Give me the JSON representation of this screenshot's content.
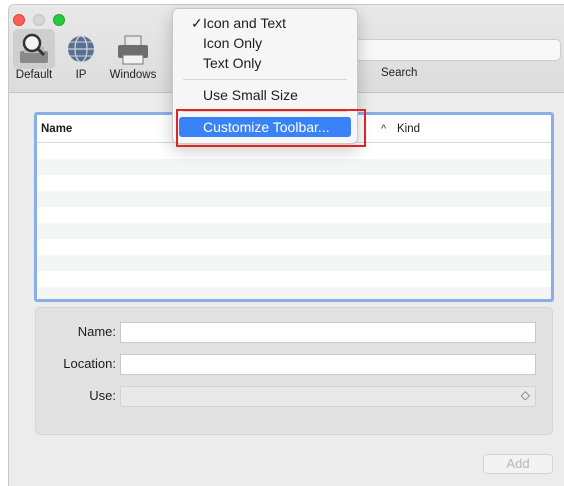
{
  "toolbar": {
    "items": [
      {
        "label": "Default",
        "icon": "magnifier-printer-icon",
        "selected": true
      },
      {
        "label": "IP",
        "icon": "globe-icon",
        "selected": false
      },
      {
        "label": "Windows",
        "icon": "printer-icon",
        "selected": false
      }
    ],
    "search_label": "Search"
  },
  "context_menu": {
    "items": [
      {
        "label": "Icon and Text",
        "checked": true
      },
      {
        "label": "Icon Only",
        "checked": false
      },
      {
        "label": "Text Only",
        "checked": false
      },
      {
        "label": "Use Small Size",
        "checked": false
      },
      {
        "label": "Customize Toolbar...",
        "highlighted": true
      }
    ],
    "check_glyph": "✓"
  },
  "table": {
    "columns": [
      "Name",
      "Kind"
    ],
    "sort_indicator": "^"
  },
  "form": {
    "name_label": "Name:",
    "location_label": "Location:",
    "use_label": "Use:",
    "name_value": "",
    "location_value": "",
    "use_value": "",
    "use_chevron": "◇"
  },
  "buttons": {
    "add_label": "Add"
  },
  "colors": {
    "highlight": "#3a82f7",
    "annotation_box": "#e02424",
    "table_focus_ring": "#8aaee8"
  }
}
